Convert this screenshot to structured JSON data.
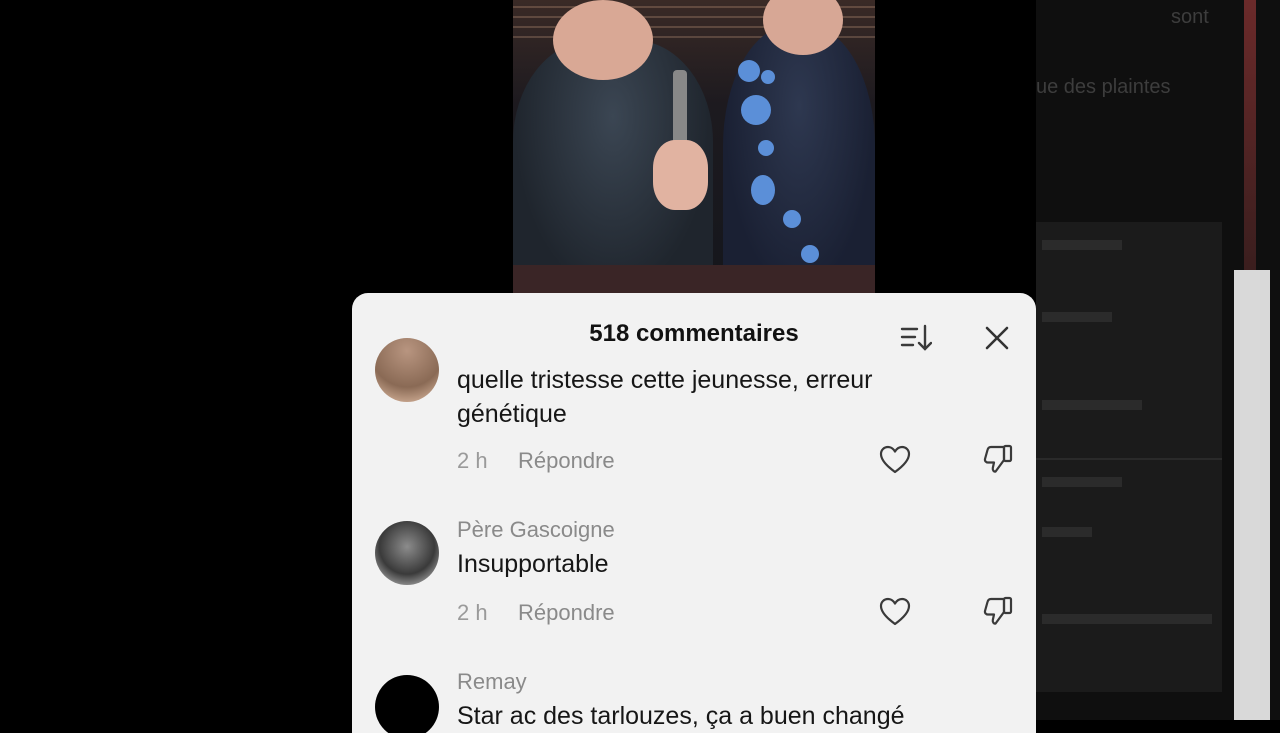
{
  "sheet": {
    "title": "518 commentaires"
  },
  "comments": [
    {
      "username": "",
      "text": "quelle tristesse cette jeunesse, erreur génétique",
      "time": "2 h",
      "reply_label": "Répondre"
    },
    {
      "username": "Père Gascoigne",
      "text": "Insupportable",
      "time": "2 h",
      "reply_label": "Répondre"
    },
    {
      "username": "Remay",
      "text": "Star ac des tarlouzes, ça a buen changé",
      "time": "",
      "reply_label": ""
    }
  ],
  "background_page": {
    "top_text": "sont",
    "second_text": "ue des plaintes"
  },
  "colors": {
    "sheet_bg": "#f2f2f2",
    "text_primary": "#161616",
    "text_secondary": "#8a8a8a"
  },
  "icons": {
    "sort": "sort-icon",
    "close": "close-icon",
    "like": "heart-icon",
    "dislike": "thumbs-down-icon"
  }
}
